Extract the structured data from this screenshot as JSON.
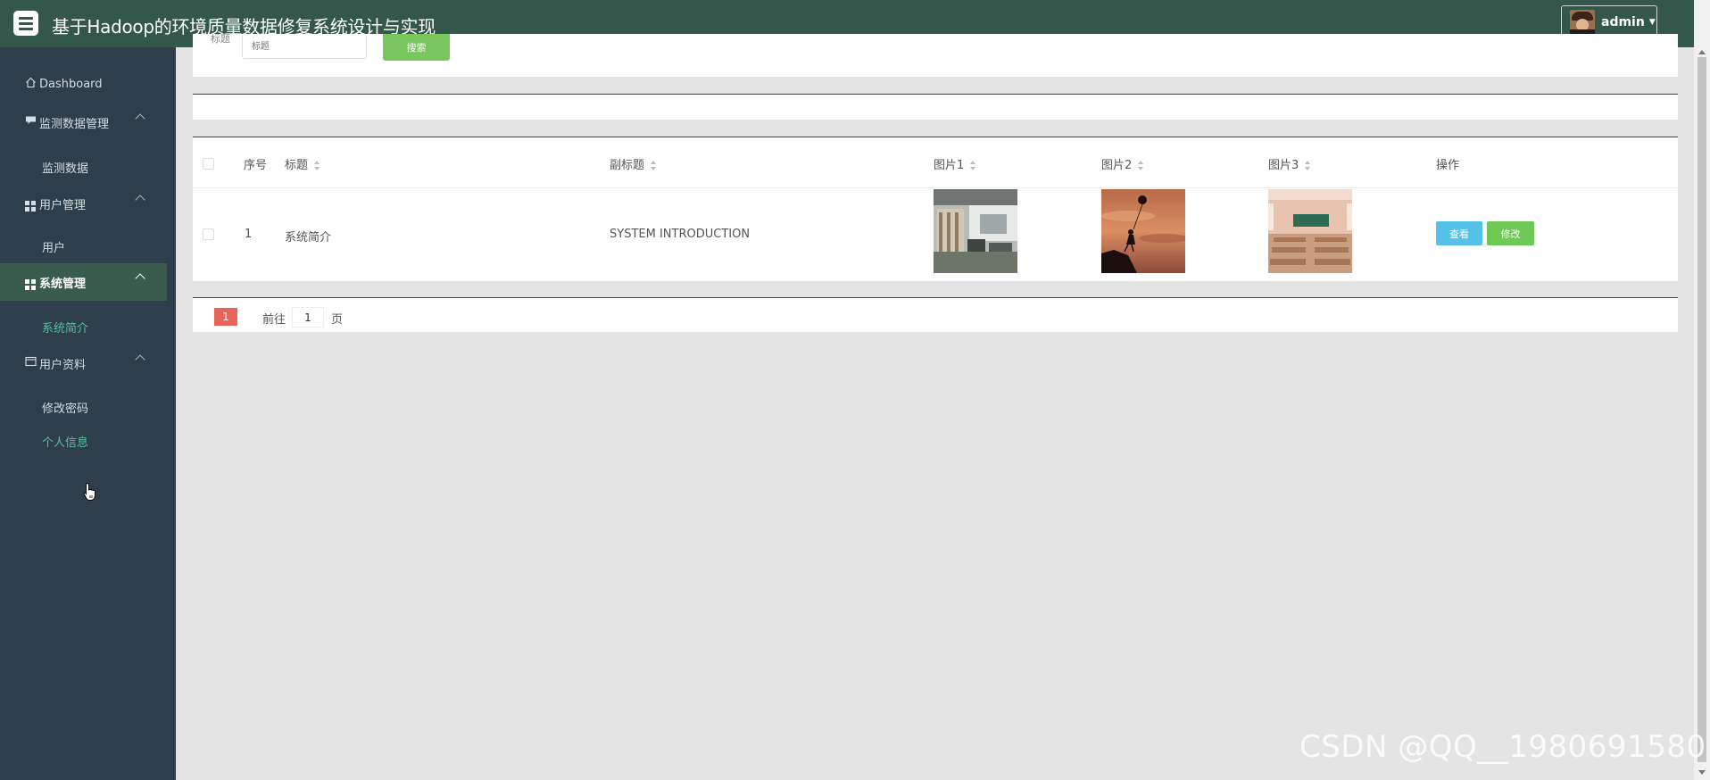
{
  "header": {
    "title": "基于Hadoop的环境质量数据修复系统设计与实现",
    "user": "admin"
  },
  "sidebar": {
    "dashboard": "Dashboard",
    "groups": [
      {
        "label": "监测数据管理",
        "items": [
          "监测数据"
        ]
      },
      {
        "label": "用户管理",
        "items": [
          "用户"
        ]
      },
      {
        "label": "系统管理",
        "items": [
          "系统简介"
        ]
      },
      {
        "label": "用户资料",
        "items": [
          "修改密码",
          "个人信息"
        ]
      }
    ]
  },
  "search": {
    "label": "标题",
    "placeholder": "标题",
    "button": "搜索"
  },
  "table": {
    "columns": [
      "序号",
      "标题",
      "副标题",
      "图片1",
      "图片2",
      "图片3",
      "操作"
    ],
    "rows": [
      {
        "index": "1",
        "title": "系统简介",
        "subtitle": "SYSTEM INTRODUCTION",
        "view": "查看",
        "edit": "修改"
      }
    ]
  },
  "pagination": {
    "current_page": "1",
    "goto_label": "前往",
    "goto_value": "1",
    "unit": "页"
  },
  "watermark": "CSDN @QQ__1980691580"
}
